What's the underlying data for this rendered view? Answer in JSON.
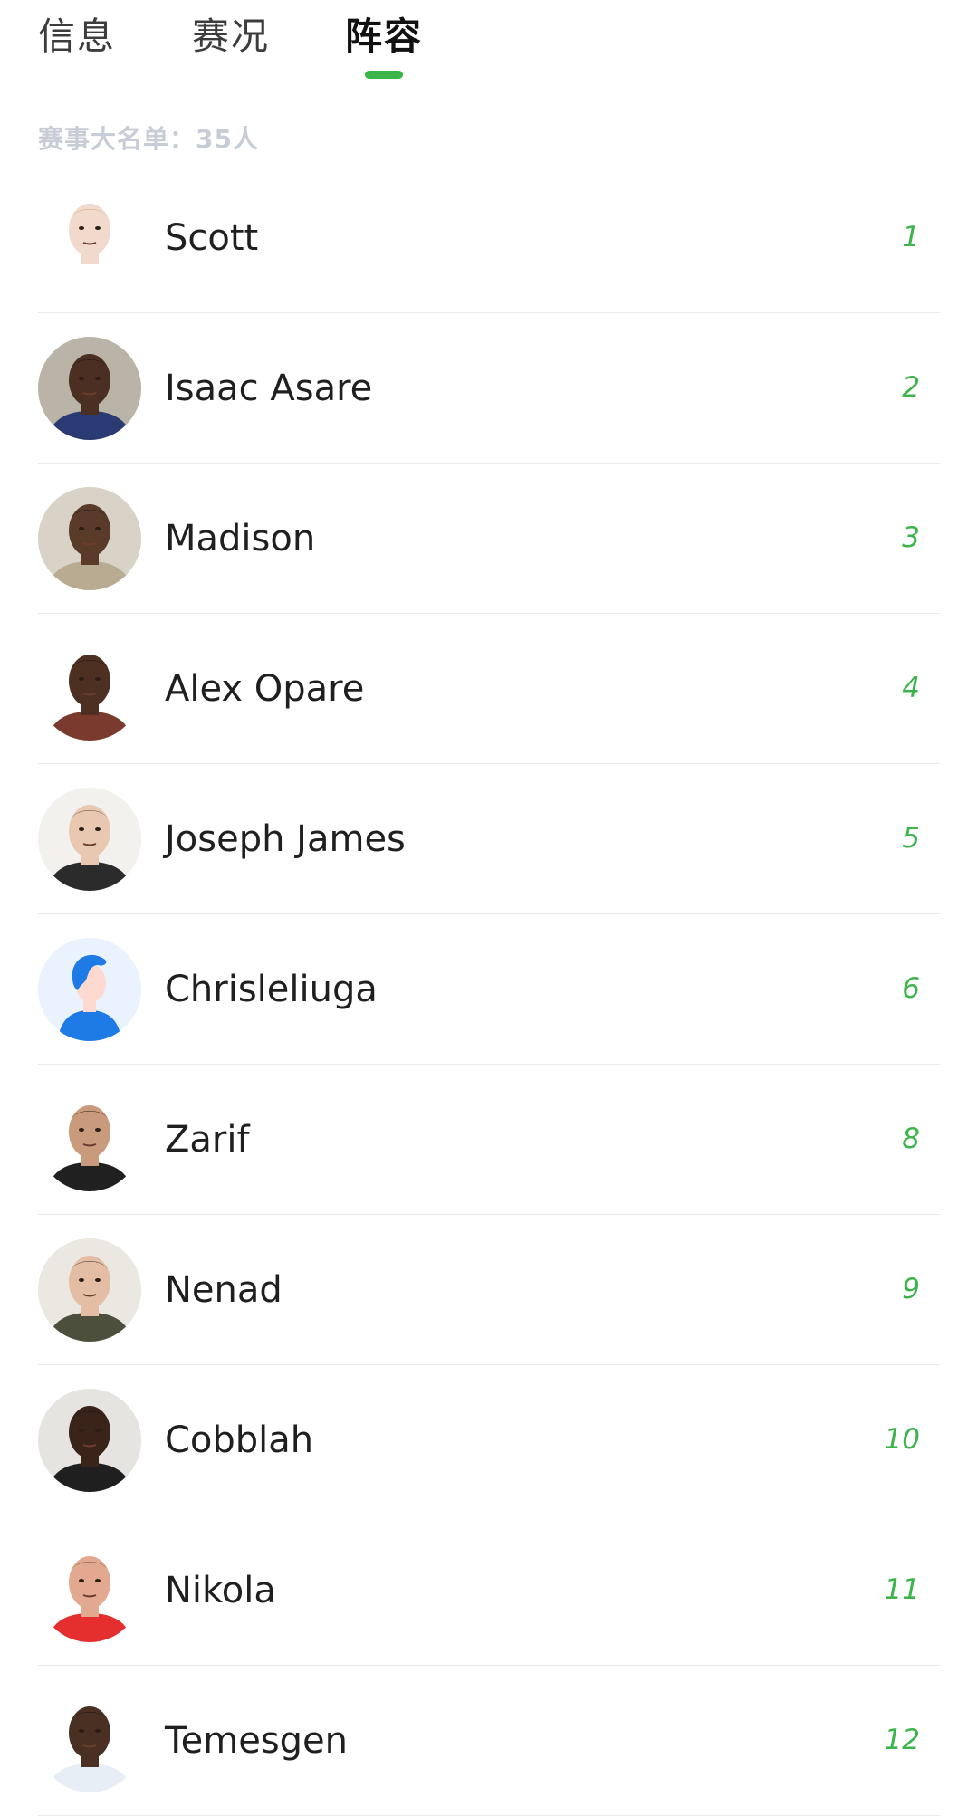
{
  "tabs": [
    {
      "label": "信息",
      "active": false
    },
    {
      "label": "赛况",
      "active": false
    },
    {
      "label": "阵容",
      "active": true
    }
  ],
  "roster_count": "赛事大名单：35人",
  "colors": {
    "accent": "#3bb54a",
    "roster_count_text": "#c7cdd6",
    "divider": "#e9e9e9"
  },
  "players": [
    {
      "name": "Scott",
      "number": "1",
      "avatar": "photo-light-skin",
      "skin": "#f1d9cc",
      "hair": "#c9a27c",
      "shirt": "#ffffff",
      "bg": "#ffffff"
    },
    {
      "name": "Isaac Asare",
      "number": "2",
      "avatar": "photo-dark-skin",
      "skin": "#4a2f22",
      "hair": "#1a1210",
      "shirt": "#2a3b73",
      "bg": "#b9b3a8"
    },
    {
      "name": "Madison",
      "number": "3",
      "avatar": "photo-dark-skin",
      "skin": "#5a3a28",
      "hair": "#1a1210",
      "shirt": "#b9aa92",
      "bg": "#d8d3c6"
    },
    {
      "name": "Alex Opare",
      "number": "4",
      "avatar": "photo-dark-skin",
      "skin": "#4e3022",
      "hair": "#1a1210",
      "shirt": "#7b3a2e",
      "bg": "#ffffff"
    },
    {
      "name": "Joseph James",
      "number": "5",
      "avatar": "photo-light-skin",
      "skin": "#e9c8b2",
      "hair": "#5a3e2c",
      "shirt": "#2b2b2b",
      "bg": "#f2f1ee"
    },
    {
      "name": "Chrisleliuga",
      "number": "6",
      "avatar": "default-avatar-icon",
      "skin": "#fdd9cf",
      "hair": "#1e7be6",
      "shirt": "#1e7be6",
      "bg": "#eaf3fd"
    },
    {
      "name": "Zarif",
      "number": "8",
      "avatar": "photo-medium-skin",
      "skin": "#c99a7c",
      "hair": "#2a1d16",
      "shirt": "#202020",
      "bg": "#ffffff"
    },
    {
      "name": "Nenad",
      "number": "9",
      "avatar": "photo-light-skin",
      "skin": "#e4bea4",
      "hair": "#2e2119",
      "shirt": "#4b4f3c",
      "bg": "#ebe7e1"
    },
    {
      "name": "Cobblah",
      "number": "10",
      "avatar": "photo-dark-skin",
      "skin": "#3a2419",
      "hair": "#141010",
      "shirt": "#1f1f1f",
      "bg": "#e5e4e1"
    },
    {
      "name": "Nikola",
      "number": "11",
      "avatar": "photo-light-skin",
      "skin": "#e2a890",
      "hair": "#6e4a34",
      "shirt": "#e52e2e",
      "bg": "#ffffff"
    },
    {
      "name": "Temesgen",
      "number": "12",
      "avatar": "photo-dark-skin",
      "skin": "#4a3022",
      "hair": "#1a1210",
      "shirt": "#e8eef5",
      "bg": "#ffffff"
    }
  ]
}
